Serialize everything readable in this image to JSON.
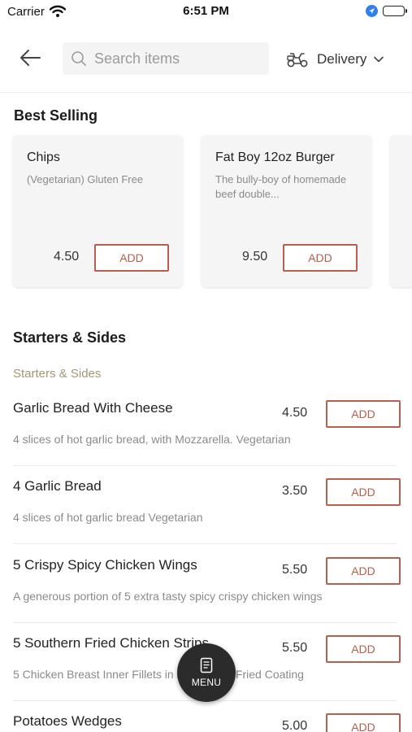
{
  "status_bar": {
    "carrier": "Carrier",
    "time": "6:51 PM"
  },
  "nav": {
    "search_placeholder": "Search items",
    "delivery_label": "Delivery"
  },
  "best_selling": {
    "title": "Best Selling",
    "cards": [
      {
        "name": "Chips",
        "description": "(Vegetarian) Gluten Free",
        "price": "4.50",
        "add_label": "ADD"
      },
      {
        "name": "Fat Boy 12oz Burger",
        "description": "The bully-boy of homemade beef double...",
        "price": "9.50",
        "add_label": "ADD"
      }
    ]
  },
  "category": {
    "title": "Starters & Sides",
    "subtitle": "Starters & Sides",
    "items": [
      {
        "name": "Garlic Bread With Cheese",
        "price": "4.50",
        "add_label": "ADD",
        "description": "4 slices of hot garlic bread, with Mozzarella.   Vegetarian"
      },
      {
        "name": "4 Garlic Bread",
        "price": "3.50",
        "add_label": "ADD",
        "description": "4 slices of hot garlic bread   Vegetarian"
      },
      {
        "name": "5 Crispy Spicy Chicken Wings",
        "price": "5.50",
        "add_label": "ADD",
        "description": "A generous portion of 5 extra tasty spicy crispy chicken wings"
      },
      {
        "name": "5 Southern Fried Chicken Strips",
        "price": "5.50",
        "add_label": "ADD",
        "description": "5 Chicken Breast Inner Fillets in a Southern Fried Coating"
      },
      {
        "name": "Potatoes Wedges",
        "price": "5.00",
        "add_label": "ADD",
        "description": ""
      }
    ]
  },
  "fab": {
    "label": "MENU"
  },
  "colors": {
    "accent": "#b45f4f",
    "subsection": "#a39773",
    "fab_background": "#2b2b2b"
  }
}
